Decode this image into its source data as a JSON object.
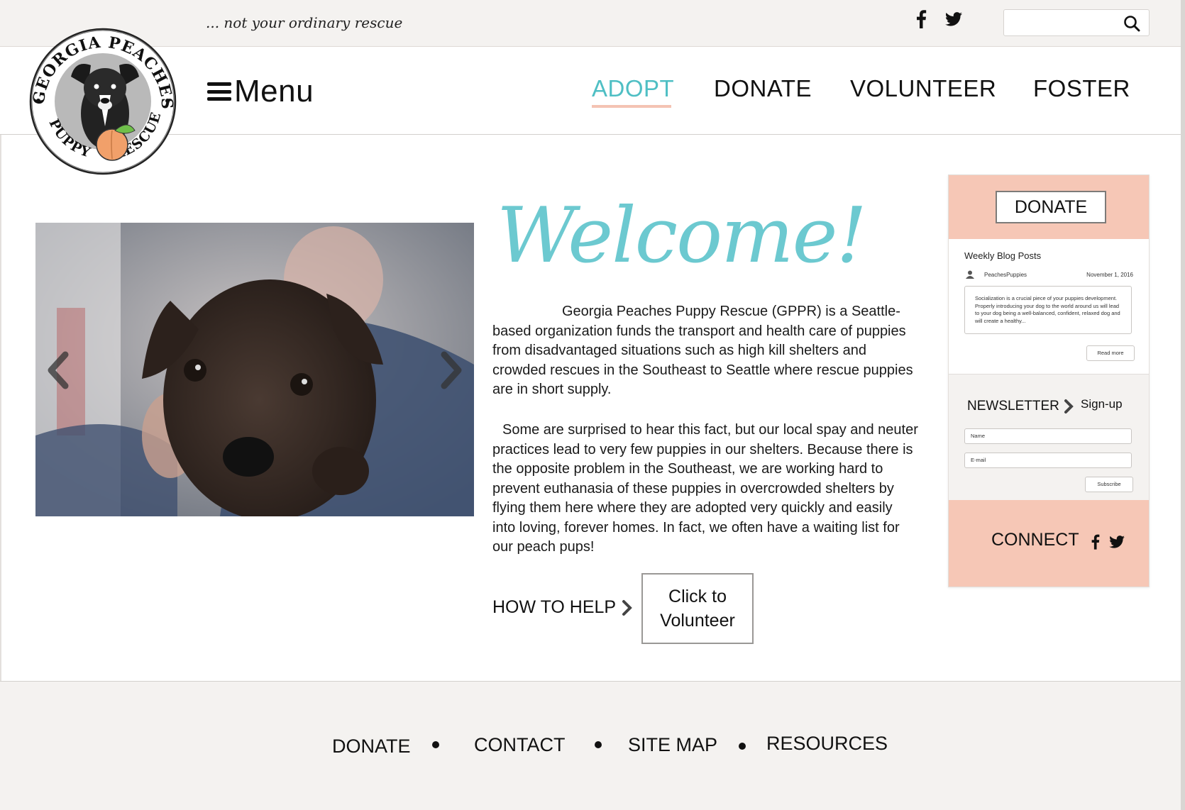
{
  "topbar": {
    "tagline": "... not your ordinary rescue",
    "social_icons": [
      "facebook-icon",
      "twitter-icon"
    ],
    "search": {
      "placeholder": "",
      "icon": "search-icon"
    }
  },
  "logo": {
    "text_top": "GEORGIA PEACHES",
    "text_bottom_left": "PUPPY",
    "text_bottom_right": "RESCUE"
  },
  "nav": {
    "menu_label": "Menu",
    "links": [
      "ADOPT",
      "DONATE",
      "VOLUNTEER",
      "FOSTER"
    ],
    "active": "ADOPT"
  },
  "main": {
    "welcome": "Welcome!",
    "paragraph1": "Georgia Peaches Puppy Rescue (GPPR) is a Seattle-based organization funds the transport and health care of puppies from disadvantaged situations such as high kill shelters and crowded rescues in the Southeast to Seattle where rescue puppies are in short supply.",
    "paragraph2": "Some are surprised to hear this fact, but our local spay and neuter practices lead to very few puppies in our shelters.  Because there is the opposite problem in the Southeast, we are working hard to prevent euthanasia of these puppies in overcrowded shelters by flying them here where they are adopted very quickly and easily into loving, forever homes.  In fact, we often have a waiting list for our peach pups!",
    "how_to_help": "HOW TO HELP",
    "volunteer_button": "Click to Volunteer"
  },
  "sidebar": {
    "donate_button": "DONATE",
    "blog": {
      "title": "Weekly Blog Posts",
      "author": "PeachesPuppies",
      "date": "November 1, 2016",
      "excerpt": "Socialization is a crucial piece of your puppies development. Properly introducing your dog to the world around us will lead to your dog being a well-balanced, confident, relaxed dog and will create a healthy...",
      "read_more": "Read more"
    },
    "newsletter": {
      "label": "NEWSLETTER",
      "signup": "Sign-up",
      "name_placeholder": "Name",
      "email_placeholder": "E-mail",
      "subscribe": "Subscribe"
    },
    "connect": "CONNECT"
  },
  "footer": {
    "links": [
      "DONATE",
      "CONTACT",
      "SITE MAP",
      "RESOURCES"
    ]
  },
  "colors": {
    "accent_teal": "#4fbfc4",
    "peach": "#f6c7b6",
    "light_bg": "#f4f2f0"
  }
}
